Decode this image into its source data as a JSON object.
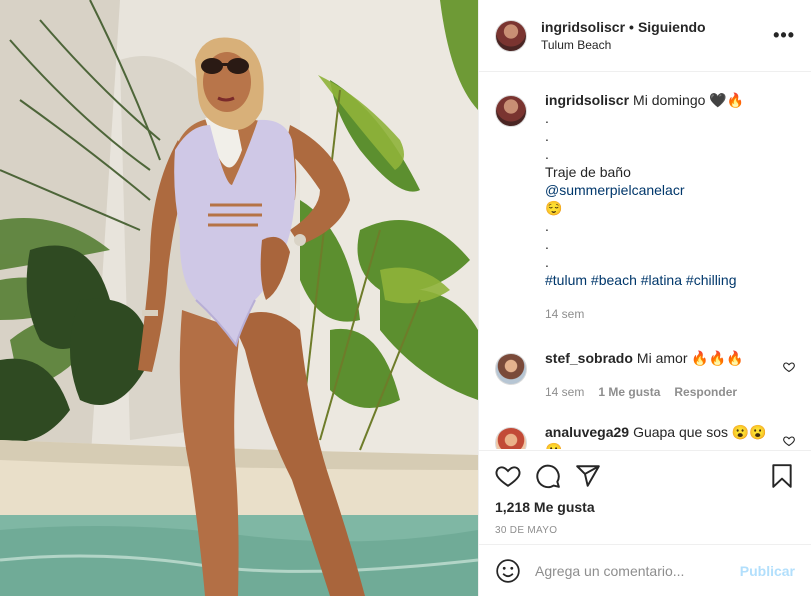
{
  "post": {
    "username": "ingridsoliscr",
    "separator": "•",
    "follow_state": "Siguiendo",
    "location": "Tulum Beach",
    "more_icon": "more-horizontal-icon"
  },
  "caption": {
    "username": "ingridsoliscr",
    "lines": [
      "Mi domingo 🖤🔥",
      ".",
      ".",
      ".",
      "Traje de baño",
      "😌",
      ".",
      ".",
      ".",
      "#tulum #beach #latina #chilling"
    ],
    "mention": "@summerpielcanelacr",
    "hashtags": [
      "#tulum",
      "#beach",
      "#latina",
      "#chilling"
    ],
    "time": "14 sem"
  },
  "comments": [
    {
      "username": "stef_sobrado",
      "text": "Mi amor 🔥🔥🔥",
      "time": "14 sem",
      "likes": "1 Me gusta",
      "reply": "Responder"
    },
    {
      "username": "analuvega29",
      "text": "Guapa que sos 😮😮😮"
    }
  ],
  "actions": {
    "likes": "1,218 Me gusta",
    "date": "30 DE MAYO"
  },
  "composer": {
    "placeholder": "Agrega un comentario...",
    "publish": "Publicar"
  },
  "colors": {
    "link": "#00376b",
    "muted": "#8e8e8e",
    "publish_disabled": "#b2dffc",
    "border": "#efefef"
  }
}
